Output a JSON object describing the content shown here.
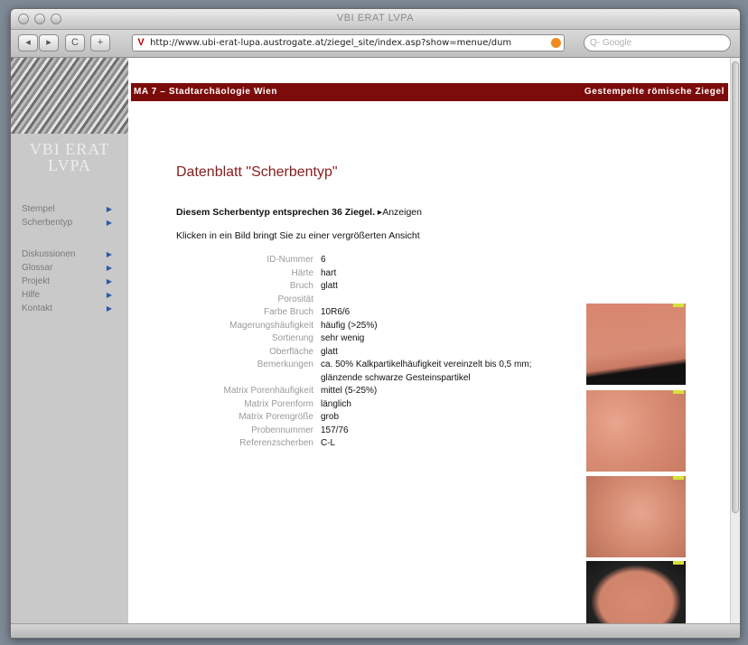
{
  "window": {
    "title": "VBI ERAT LVPA"
  },
  "toolbar": {
    "back_label": "◂",
    "forward_label": "▸",
    "reload_label": "C",
    "add_label": "+",
    "favicon": "V",
    "url": "http://www.ubi-erat-lupa.austrogate.at/ziegel_site/index.asp?show=menue/dum",
    "search_placeholder": "Q- Google"
  },
  "sidebar": {
    "logo_text": "VBI ERAT LVPA",
    "items_top": [
      {
        "label": "Stempel"
      },
      {
        "label": "Scherbentyp"
      }
    ],
    "items_bottom": [
      {
        "label": "Diskussionen"
      },
      {
        "label": "Glossar"
      },
      {
        "label": "Projekt"
      },
      {
        "label": "Hilfe"
      },
      {
        "label": "Kontakt"
      }
    ]
  },
  "banner": {
    "left": "MA 7 – Stadtarchäologie Wien",
    "right": "Gestempelte römische Ziegel"
  },
  "page": {
    "heading": "Datenblatt \"Scherbentyp\"",
    "count_text": "Diesem Scherbentyp entsprechen 36 Ziegel.",
    "count_link": "▸Anzeigen",
    "hint": "Klicken in ein Bild bringt Sie zu einer vergrößerten Ansicht"
  },
  "fields": [
    {
      "label": "ID-Nummer",
      "value": "6"
    },
    {
      "label": "Härte",
      "value": "hart"
    },
    {
      "label": "Bruch",
      "value": "glatt"
    },
    {
      "label": "Porosität",
      "value": ""
    },
    {
      "label": "Farbe Bruch",
      "value": "10R6/6"
    },
    {
      "label": "Magerungshäufigkeit",
      "value": "häufig (>25%)"
    },
    {
      "label": "Sortierung",
      "value": "sehr wenig"
    },
    {
      "label": "Oberfläche",
      "value": "glatt"
    },
    {
      "label": "Bemerkungen",
      "value": "ca. 50% Kalkpartikelhäufigkeit vereinzelt bis 0,5 mm; glänzende schwarze Gesteinspartikel"
    },
    {
      "label": "Matrix Porenhäufigkeit",
      "value": "mittel (5-25%)"
    },
    {
      "label": "Matrix Porenform",
      "value": "länglich"
    },
    {
      "label": "Matrix Porengröße",
      "value": "grob"
    },
    {
      "label": "Probennummer",
      "value": "157/76"
    },
    {
      "label": "Referenzscherben",
      "value": "C-L"
    }
  ],
  "colors": {
    "banner": "#7c0c0c",
    "heading": "#8b1a1a",
    "nav_arrow": "#2a5aa8"
  }
}
